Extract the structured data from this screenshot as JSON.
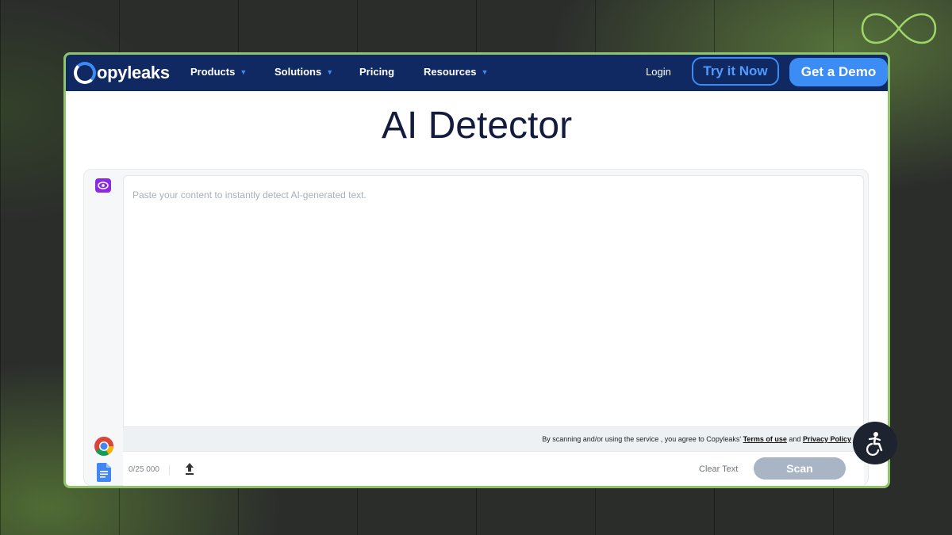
{
  "brand": {
    "name": "Copyleaks",
    "logo_rest": "opyleaks",
    "accent": "#3b8cf5",
    "nav_bg": "#112962",
    "frame_border": "#8fc46a"
  },
  "nav": {
    "items": [
      {
        "label": "Products",
        "has_dropdown": true
      },
      {
        "label": "Solutions",
        "has_dropdown": true
      },
      {
        "label": "Pricing",
        "has_dropdown": false
      },
      {
        "label": "Resources",
        "has_dropdown": true
      }
    ],
    "login": "Login",
    "try_now": "Try it Now",
    "get_demo": "Get a Demo"
  },
  "page": {
    "title": "AI Detector"
  },
  "editor": {
    "placeholder": "Paste your content to instantly detect AI-generated text.",
    "value": ""
  },
  "consent": {
    "prefix": "By scanning and/or using the service , you agree to Copyleaks' ",
    "terms": "Terms of use",
    "and": " and ",
    "privacy": "Privacy Policy"
  },
  "footer": {
    "counter": "0/25 000",
    "clear_text": "Clear Text",
    "scan": "Scan"
  },
  "icons": {
    "eye": "eye-icon",
    "chrome": "chrome-icon",
    "gdocs": "google-docs-icon",
    "upload": "upload-icon",
    "accessibility": "accessibility-icon",
    "infinity": "infinity-icon"
  }
}
